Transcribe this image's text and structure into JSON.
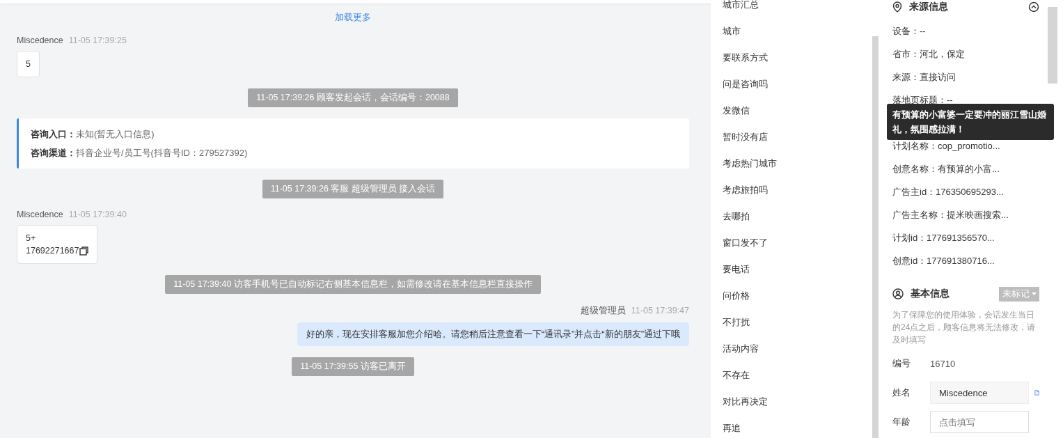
{
  "chat": {
    "load_more": "加载更多",
    "messages": [
      {
        "kind": "visitor",
        "sender": "Miscedence",
        "time": "11-05 17:39:25",
        "lines": [
          "5"
        ],
        "copyable": false
      },
      {
        "kind": "system",
        "text": "11-05 17:39:26 顾客发起会话，会话编号：20088"
      },
      {
        "kind": "entry",
        "lines": [
          {
            "label": "咨询入口：",
            "value": "未知(暂无入口信息)"
          },
          {
            "label": "咨询渠道：",
            "value": "抖音企业号/员工号(抖音号ID：279527392)"
          }
        ]
      },
      {
        "kind": "system",
        "text": "11-05 17:39:26 客服 超级管理员 接入会话"
      },
      {
        "kind": "visitor",
        "sender": "Miscedence",
        "time": "11-05 17:39:40",
        "lines": [
          "5+",
          "17692271667"
        ],
        "copyable": true
      },
      {
        "kind": "system",
        "text": "11-05 17:39:40 访客手机号已自动标记右侧基本信息栏，如需修改请在基本信息栏直接操作"
      },
      {
        "kind": "agent",
        "sender": "超级管理员",
        "time": "11-05 17:39:47",
        "lines": [
          "好的亲，现在安排客服加您介绍哈。请您稍后注意查看一下“通讯录”并点击“新的朋友”通过下哦"
        ],
        "copyable": false
      },
      {
        "kind": "system",
        "text": "11-05 17:39:55 访客已离开"
      }
    ]
  },
  "quick_replies": [
    "城市汇总",
    "城市",
    "要联系方式",
    "问是咨询吗",
    "发微信",
    "暂时没有店",
    "考虑热门城市",
    "考虑旅拍吗",
    "去哪拍",
    "窗口发不了",
    "要电话",
    "问价格",
    "不打扰",
    "活动内容",
    "不存在",
    "对比再决定",
    "再追"
  ],
  "source_info": {
    "title": "来源信息",
    "fields": [
      {
        "kind": "text",
        "text": "设备：--"
      },
      {
        "kind": "text",
        "text": "省市：河北，保定"
      },
      {
        "kind": "text",
        "text": "来源：直接访问"
      },
      {
        "kind": "text",
        "text": "落地页标题：--"
      },
      {
        "kind": "tooltip",
        "text": "有预算的小富婆一定要冲的丽江雪山婚礼，氛围感拉满！"
      },
      {
        "kind": "text",
        "text": "计划名称：cop_promotio..."
      },
      {
        "kind": "text",
        "text": "创意名称：有预算的小富..."
      },
      {
        "kind": "text",
        "text": "广告主id：176350695293..."
      },
      {
        "kind": "text",
        "text": "广告主名称：提米映画搜索..."
      },
      {
        "kind": "text",
        "text": "计划id：177691356570..."
      },
      {
        "kind": "text",
        "text": "创意id：177691380716..."
      }
    ]
  },
  "basic_info": {
    "title": "基本信息",
    "tag": "未标记",
    "note": "为了保障您的使用体验，会话发生当日的24点之后，顾客信息将无法修改，请及时填写",
    "fields": [
      {
        "kind": "text",
        "label": "编号",
        "value": "16710"
      },
      {
        "kind": "copy_input",
        "label": "姓名",
        "value": "Miscedence"
      },
      {
        "kind": "input",
        "label": "年龄",
        "placeholder": "点击填写"
      }
    ]
  }
}
